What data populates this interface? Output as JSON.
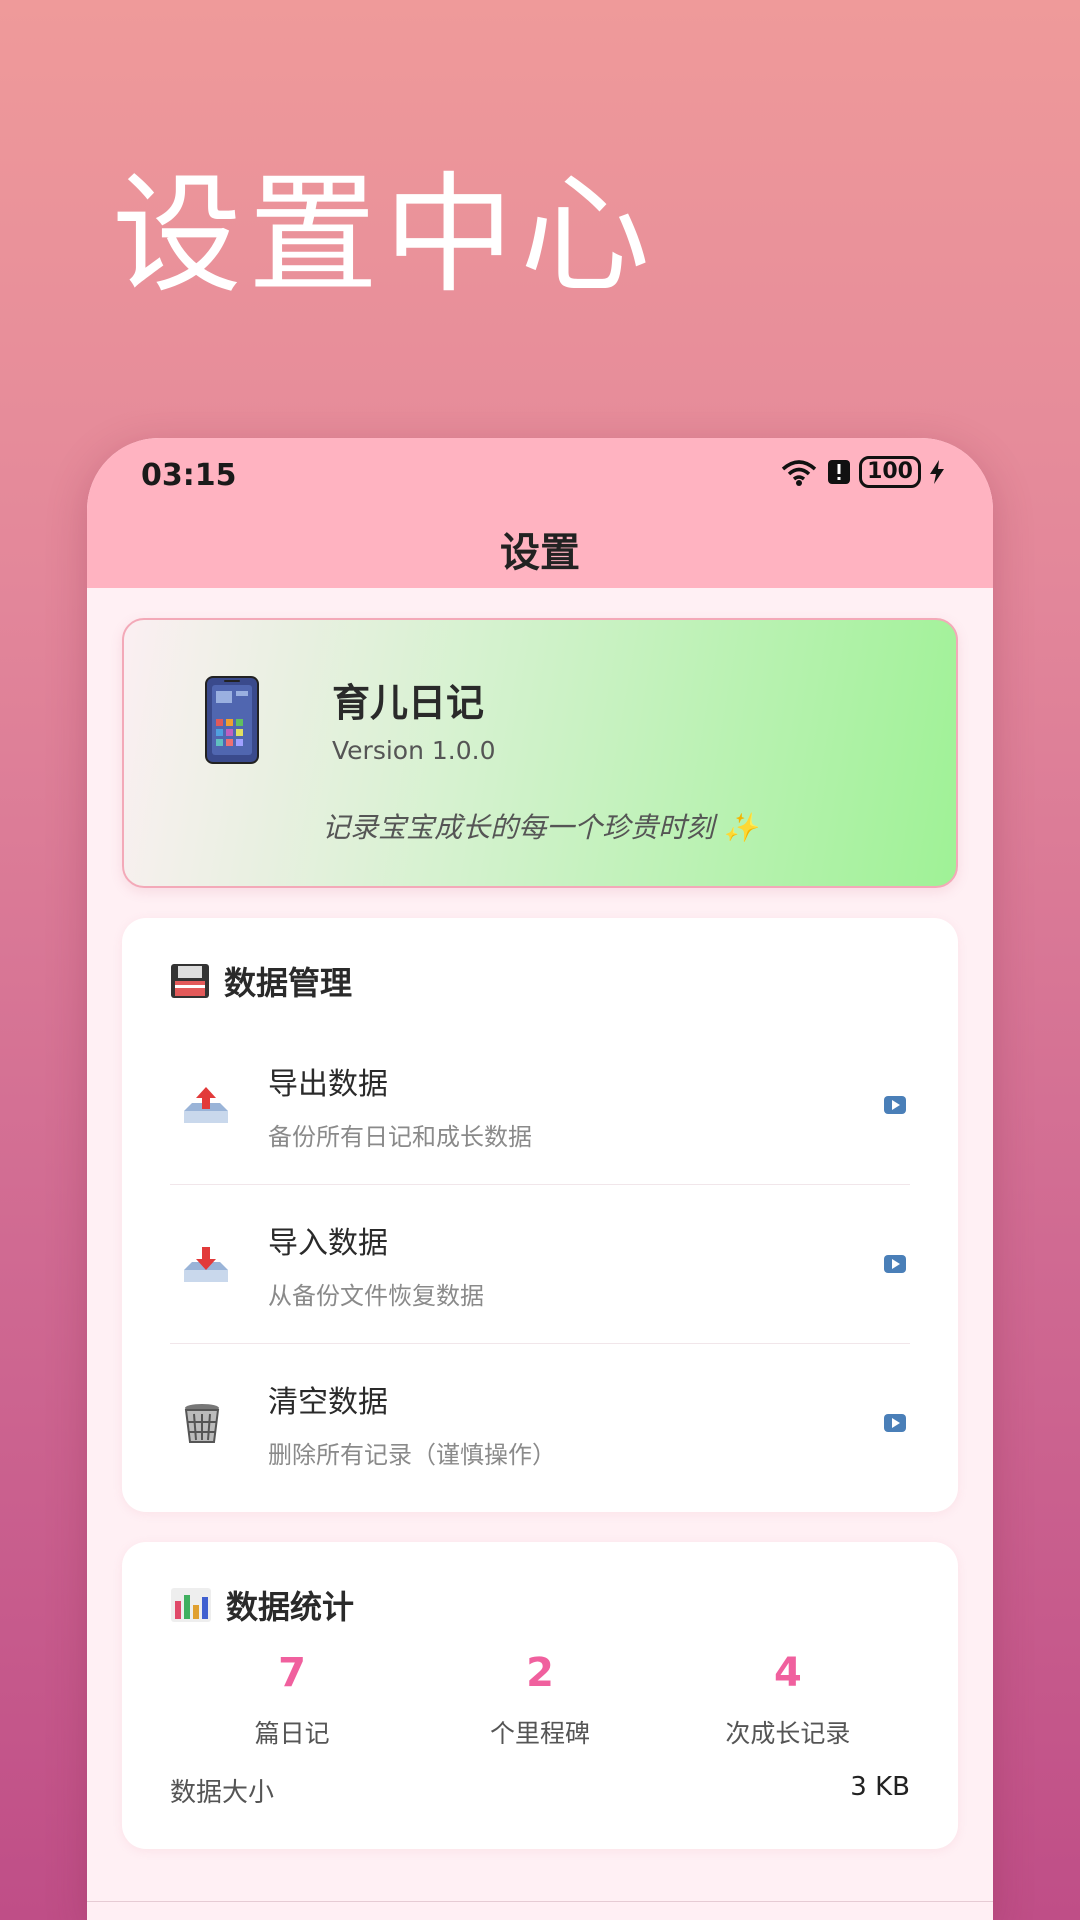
{
  "promo": {
    "title": "设置中心"
  },
  "status_bar": {
    "time": "03:15",
    "battery": "100"
  },
  "app_bar": {
    "title": "设置"
  },
  "about": {
    "name": "育儿日记",
    "version": "Version 1.0.0",
    "slogan": "记录宝宝成长的每一个珍贵时刻 ✨"
  },
  "data_management": {
    "title": "数据管理",
    "items": [
      {
        "title": "导出数据",
        "subtitle": "备份所有日记和成长数据",
        "icon": "export-tray-icon"
      },
      {
        "title": "导入数据",
        "subtitle": "从备份文件恢复数据",
        "icon": "import-tray-icon"
      },
      {
        "title": "清空数据",
        "subtitle": "删除所有记录（谨慎操作）",
        "icon": "trash-icon"
      }
    ]
  },
  "statistics": {
    "title": "数据统计",
    "items": [
      {
        "value": "7",
        "label": "篇日记"
      },
      {
        "value": "2",
        "label": "个里程碑"
      },
      {
        "value": "4",
        "label": "次成长记录"
      }
    ],
    "size_label": "数据大小",
    "size_value": "3 KB"
  },
  "colors": {
    "accent": "#f0609e",
    "appbar": "#ffb3c1",
    "arrow": "#4a7fb8"
  }
}
